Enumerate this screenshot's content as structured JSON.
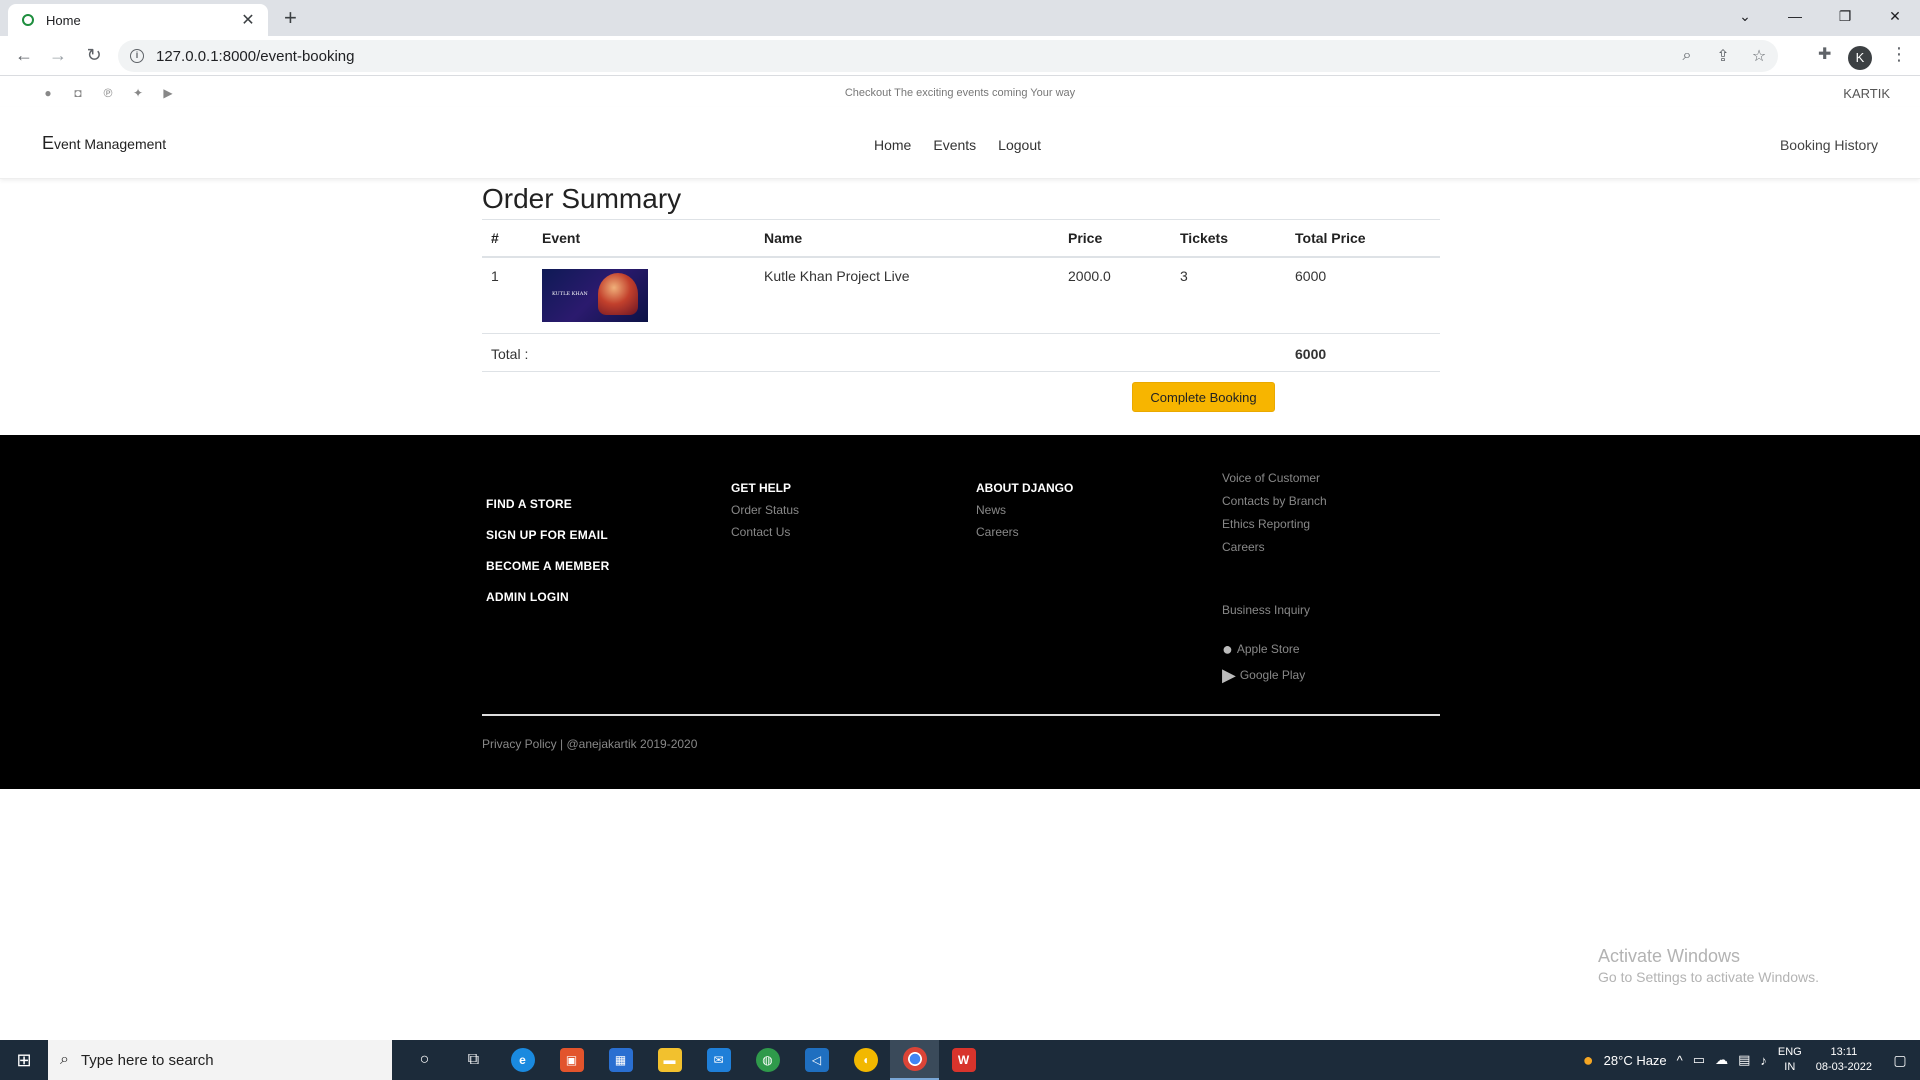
{
  "browser": {
    "tab_title": "Home",
    "new_tab": "+",
    "url": "127.0.0.1:8000/event-booking",
    "profile_initial": "K",
    "window_controls": {
      "dropdown": "⌄",
      "minimize": "—",
      "restore": "❐",
      "close": "✕"
    }
  },
  "topstrip": {
    "promo": "Checkout The exciting events coming Your way",
    "user": "KARTIK",
    "social_icons": [
      "facebook-icon",
      "instagram-icon",
      "pinterest-icon",
      "twitter-icon",
      "youtube-icon"
    ]
  },
  "navbar": {
    "brand_first": "E",
    "brand_rest": "vent Management",
    "links": [
      "Home",
      "Events",
      "Logout"
    ],
    "booking_history": "Booking History"
  },
  "order": {
    "title": "Order Summary",
    "columns": [
      "#",
      "Event",
      "Name",
      "Price",
      "Tickets",
      "Total Price"
    ],
    "rows": [
      {
        "index": "1",
        "event_image": "event-poster-image",
        "poster_text": "KUTLE KHAN",
        "name": "Kutle Khan Project Live",
        "price": "2000.0",
        "tickets": "3",
        "total": "6000"
      }
    ],
    "total_label": "Total :",
    "total_value": "6000",
    "complete_button": "Complete Booking"
  },
  "footer": {
    "col1": [
      "FIND A STORE",
      "SIGN UP FOR EMAIL",
      "BECOME A MEMBER",
      "ADMIN LOGIN"
    ],
    "col2": {
      "heading": "GET HELP",
      "links": [
        "Order Status",
        "Contact Us"
      ]
    },
    "col3": {
      "heading": "ABOUT DJANGO",
      "links": [
        "News",
        "Careers"
      ]
    },
    "col4": {
      "links": [
        "Voice of Customer",
        "Contacts by Branch",
        "Ethics Reporting",
        "Careers"
      ],
      "inquiry": "Business Inquiry",
      "apple": "Apple Store",
      "google": "Google Play"
    },
    "copyright": "Privacy Policy | @anejakartik 2019-2020"
  },
  "watermark": {
    "line1": "Activate Windows",
    "line2": "Go to Settings to activate Windows."
  },
  "taskbar": {
    "search_placeholder": "Type here to search",
    "weather": "28°C  Haze",
    "lang_top": "ENG",
    "lang_bottom": "IN",
    "time": "13:11",
    "date": "08-03-2022"
  }
}
